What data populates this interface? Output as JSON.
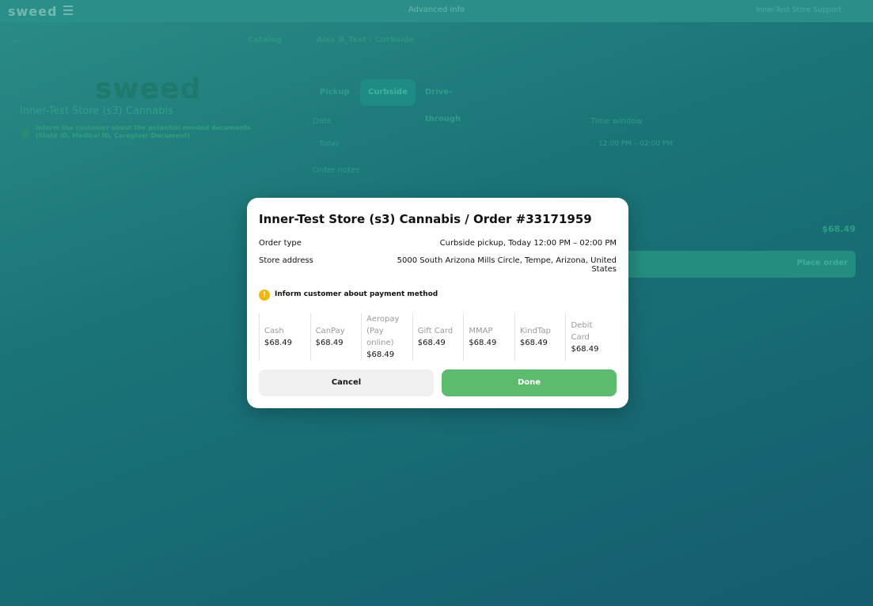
{
  "background": {
    "logo": "sweed",
    "top_center": "Advanced info",
    "top_right": "Inner-Test Store Support",
    "breadcrumbs": [
      "Catalog",
      "Alex B_Test / Curbside"
    ],
    "store_title": "Inner-Test Store (s3) Cannabis",
    "info_text": "Inform the customer about the potential needed documents (State ID, Medical ID, Caregiver Document)",
    "tabs": [
      {
        "label": "Pickup"
      },
      {
        "label": "Curbside"
      },
      {
        "label": "Drive-through"
      }
    ],
    "date_label": "Date",
    "date_value": "Today",
    "time_label": "Time window",
    "time_value": "12:00 PM – 02:00 PM",
    "notes_label": "Order notes",
    "total": "$68.49",
    "place_order": "Place order"
  },
  "modal": {
    "title": "Inner-Test Store (s3) Cannabis / Order #33171959",
    "order_type_label": "Order type",
    "order_type_value": "Curbside pickup, Today 12:00 PM – 02:00 PM",
    "store_address_label": "Store address",
    "store_address_line1": "5000 South Arizona Mills Circle, Tempe, Arizona, United",
    "store_address_line2": "States",
    "warning_text": "Inform customer about payment method",
    "payment_methods": [
      {
        "name_lines": [
          "Cash"
        ],
        "amount": "$68.49"
      },
      {
        "name_lines": [
          "CanPay"
        ],
        "amount": "$68.49"
      },
      {
        "name_lines": [
          "Aeropay",
          "(Pay",
          "online)"
        ],
        "amount": "$68.49"
      },
      {
        "name_lines": [
          "Gift Card"
        ],
        "amount": "$68.49"
      },
      {
        "name_lines": [
          "MMAP"
        ],
        "amount": "$68.49"
      },
      {
        "name_lines": [
          "KindTap"
        ],
        "amount": "$68.49"
      },
      {
        "name_lines": [
          "Debit",
          "Card"
        ],
        "amount": "$68.49"
      }
    ],
    "cancel_label": "Cancel",
    "done_label": "Done",
    "colors": {
      "done": "#5dbb6e",
      "warning": "#f5b60c"
    }
  }
}
